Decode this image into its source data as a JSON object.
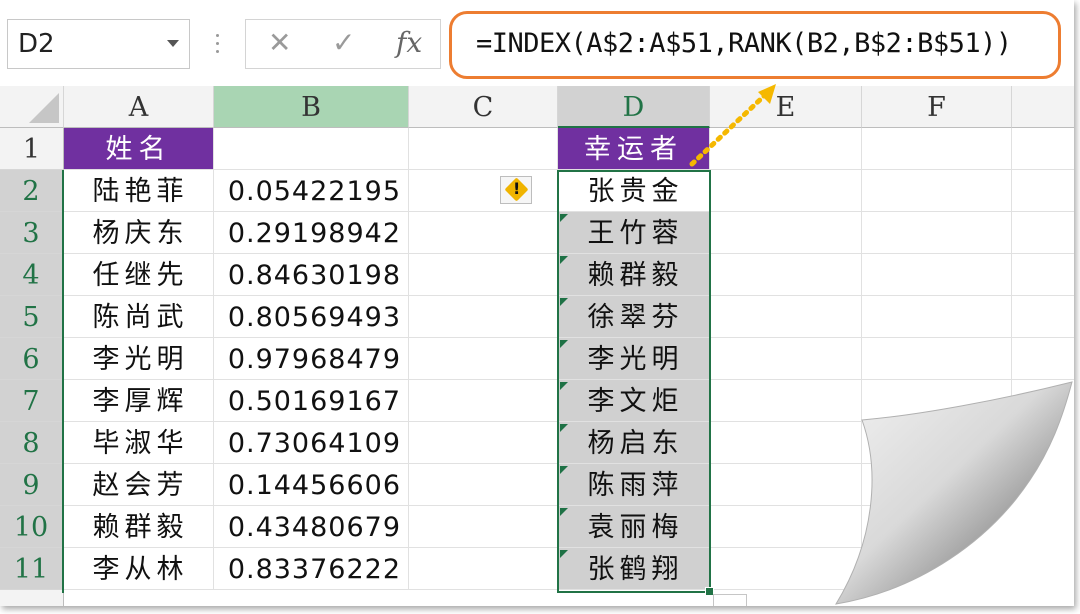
{
  "formula_bar": {
    "name_box": "D2",
    "cancel_icon": "✕",
    "enter_icon": "✓",
    "fx_label": "fx",
    "formula": "=INDEX(A$2:A$51,RANK(B2,B$2:B$51))"
  },
  "columns": [
    "A",
    "B",
    "C",
    "D",
    "E",
    "F"
  ],
  "rows": [
    "1",
    "2",
    "3",
    "4",
    "5",
    "6",
    "7",
    "8",
    "9",
    "10",
    "11"
  ],
  "header_row": {
    "A": "姓名",
    "D": "幸运者"
  },
  "data_rows": [
    {
      "name": "陆艳菲",
      "value": "0.05422195",
      "lucky": "张贵金"
    },
    {
      "name": "杨庆东",
      "value": "0.29198942",
      "lucky": "王竹蓉"
    },
    {
      "name": "任继先",
      "value": "0.84630198",
      "lucky": "赖群毅"
    },
    {
      "name": "陈尚武",
      "value": "0.80569493",
      "lucky": "徐翠芬"
    },
    {
      "name": "李光明",
      "value": "0.97968479",
      "lucky": "李光明"
    },
    {
      "name": "李厚辉",
      "value": "0.50169167",
      "lucky": "李文炬"
    },
    {
      "name": "毕淑华",
      "value": "0.73064109",
      "lucky": "杨启东"
    },
    {
      "name": "赵会芳",
      "value": "0.14456606",
      "lucky": "陈雨萍"
    },
    {
      "name": "赖群毅",
      "value": "0.43480679",
      "lucky": "袁丽梅"
    },
    {
      "name": "李从林",
      "value": "0.83376222",
      "lucky": "张鹤翔"
    }
  ],
  "colors": {
    "header_fill": "#7030a0",
    "selection": "#217346",
    "highlight": "#ed7d31",
    "error_icon": "#f0b400"
  },
  "icons": {
    "warning": "warning-icon",
    "dropdown": "chevron-down-icon",
    "arrow": "dotted-arrow-icon"
  }
}
